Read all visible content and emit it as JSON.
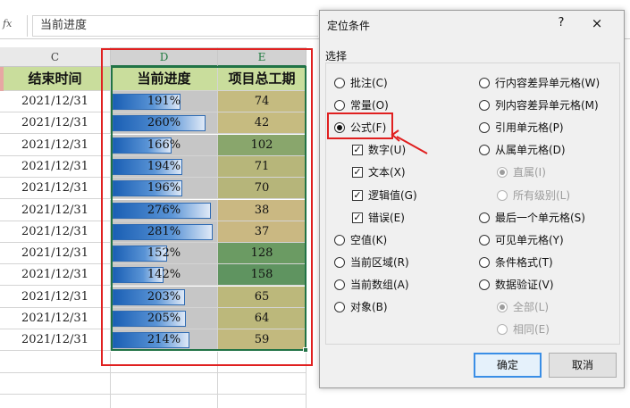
{
  "formula_bar": {
    "fx_label": "fx",
    "value": "当前进度"
  },
  "columns": [
    "C",
    "D",
    "E"
  ],
  "headers": {
    "c": "结束时间",
    "d": "当前进度",
    "e": "项目总工期"
  },
  "rows": [
    {
      "end": "2021/12/31",
      "progress": "191%",
      "pct": 191,
      "duration": "74",
      "dcolor": "#c5bb80"
    },
    {
      "end": "2021/12/31",
      "progress": "260%",
      "pct": 260,
      "duration": "42",
      "dcolor": "#c6bb80"
    },
    {
      "end": "2021/12/31",
      "progress": "166%",
      "pct": 166,
      "duration": "102",
      "dcolor": "#89a66c"
    },
    {
      "end": "2021/12/31",
      "progress": "194%",
      "pct": 194,
      "duration": "71",
      "dcolor": "#b7b67a"
    },
    {
      "end": "2021/12/31",
      "progress": "196%",
      "pct": 196,
      "duration": "70",
      "dcolor": "#b6b57a"
    },
    {
      "end": "2021/12/31",
      "progress": "276%",
      "pct": 276,
      "duration": "38",
      "dcolor": "#cab882"
    },
    {
      "end": "2021/12/31",
      "progress": "281%",
      "pct": 281,
      "duration": "37",
      "dcolor": "#cab882"
    },
    {
      "end": "2021/12/31",
      "progress": "152%",
      "pct": 152,
      "duration": "128",
      "dcolor": "#6b9b63"
    },
    {
      "end": "2021/12/31",
      "progress": "142%",
      "pct": 142,
      "duration": "158",
      "dcolor": "#5f9460"
    },
    {
      "end": "2021/12/31",
      "progress": "203%",
      "pct": 203,
      "duration": "65",
      "dcolor": "#bcb87b"
    },
    {
      "end": "2021/12/31",
      "progress": "205%",
      "pct": 205,
      "duration": "64",
      "dcolor": "#bcb87b"
    },
    {
      "end": "2021/12/31",
      "progress": "214%",
      "pct": 214,
      "duration": "59",
      "dcolor": "#c2b97e"
    }
  ],
  "dialog": {
    "title": "定位条件",
    "help": "?",
    "close": "×",
    "group_label": "选择",
    "left_options": [
      {
        "label": "批注(C)",
        "type": "radio",
        "checked": false,
        "disabled": false
      },
      {
        "label": "常量(O)",
        "type": "radio",
        "checked": false,
        "disabled": false
      },
      {
        "label": "公式(F)",
        "type": "radio",
        "checked": true,
        "disabled": false
      },
      {
        "label": "数字(U)",
        "type": "check",
        "checked": true,
        "disabled": false,
        "indent": true
      },
      {
        "label": "文本(X)",
        "type": "check",
        "checked": true,
        "disabled": false,
        "indent": true
      },
      {
        "label": "逻辑值(G)",
        "type": "check",
        "checked": true,
        "disabled": false,
        "indent": true
      },
      {
        "label": "错误(E)",
        "type": "check",
        "checked": true,
        "disabled": false,
        "indent": true
      },
      {
        "label": "空值(K)",
        "type": "radio",
        "checked": false,
        "disabled": false
      },
      {
        "label": "当前区域(R)",
        "type": "radio",
        "checked": false,
        "disabled": false
      },
      {
        "label": "当前数组(A)",
        "type": "radio",
        "checked": false,
        "disabled": false
      },
      {
        "label": "对象(B)",
        "type": "radio",
        "checked": false,
        "disabled": false
      }
    ],
    "right_options": [
      {
        "label": "行内容差异单元格(W)",
        "type": "radio",
        "checked": false,
        "disabled": false
      },
      {
        "label": "列内容差异单元格(M)",
        "type": "radio",
        "checked": false,
        "disabled": false
      },
      {
        "label": "引用单元格(P)",
        "type": "radio",
        "checked": false,
        "disabled": false
      },
      {
        "label": "从属单元格(D)",
        "type": "radio",
        "checked": false,
        "disabled": false
      },
      {
        "label": "直属(I)",
        "type": "radio",
        "checked": true,
        "disabled": true,
        "indent": true
      },
      {
        "label": "所有级别(L)",
        "type": "radio",
        "checked": false,
        "disabled": true,
        "indent": true
      },
      {
        "label": "最后一个单元格(S)",
        "type": "radio",
        "checked": false,
        "disabled": false
      },
      {
        "label": "可见单元格(Y)",
        "type": "radio",
        "checked": false,
        "disabled": false
      },
      {
        "label": "条件格式(T)",
        "type": "radio",
        "checked": false,
        "disabled": false
      },
      {
        "label": "数据验证(V)",
        "type": "radio",
        "checked": false,
        "disabled": false
      },
      {
        "label": "全部(L)",
        "type": "radio",
        "checked": true,
        "disabled": true,
        "indent": true
      },
      {
        "label": "相同(E)",
        "type": "radio",
        "checked": false,
        "disabled": true,
        "indent": true
      }
    ],
    "ok_label": "确定",
    "cancel_label": "取消"
  }
}
